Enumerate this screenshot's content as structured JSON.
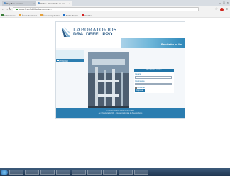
{
  "browser": {
    "tabs": [
      {
        "label": "Ray-Ban Associa...",
        "active": false
      },
      {
        "label": "Online - Resultado on line",
        "active": true
      }
    ],
    "address": "www.lincefidelidades.com.ar/...",
    "bookmarks": [
      {
        "label": "Aplicaciones",
        "icon": "apps-icon"
      },
      {
        "label": "Ícon Laboratorios",
        "icon": "folder-icon"
      },
      {
        "label": "Ícon Computación",
        "icon": "folder-icon"
      },
      {
        "label": "Minha Página",
        "icon": "page-icon"
      },
      {
        "label": "Youtube",
        "icon": "youtube-icon"
      }
    ]
  },
  "site": {
    "brand_line1": "LABORATORIOS",
    "brand_line2": "DRA. DEFELIPPO",
    "tagline": "Resultados on line",
    "menu": [
      {
        "label": "Principal"
      }
    ],
    "login": {
      "title": "Resultados on line",
      "user_label": "Usuario",
      "pass_label": "Contraseña",
      "remember_label": "Recordar",
      "submit_label": "Ingresar"
    },
    "footer_line1": "LABORATORIOS DRA. DEFELIPPO",
    "footer_line2": "Av. Rivadavia 12.345 - Ciudad Autónoma de Buenos Aires"
  },
  "colors": {
    "brand_blue": "#2b7db0",
    "logo_text": "#2a5a86"
  }
}
